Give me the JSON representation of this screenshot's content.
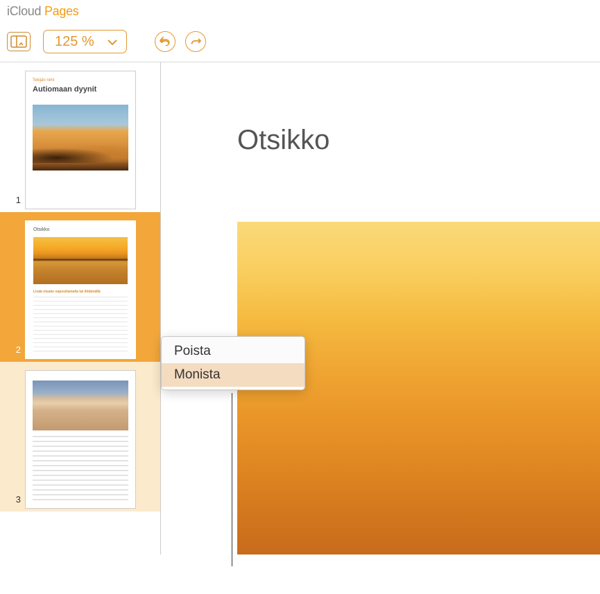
{
  "brand": {
    "icloud": "iCloud",
    "pages": "Pages"
  },
  "toolbar": {
    "zoom_value": "125 %"
  },
  "sidebar": {
    "pages": [
      {
        "num": "1",
        "author_label": "Tekijän nimi",
        "title": "Autiomaan dyynit"
      },
      {
        "num": "2",
        "heading": "Otsikko",
        "subheading": "Lisää otsake napsuttamalla tai liittämällä"
      },
      {
        "num": "3"
      }
    ]
  },
  "canvas": {
    "heading": "Otsikko"
  },
  "context_menu": {
    "items": [
      {
        "label": "Poista"
      },
      {
        "label": "Monista"
      }
    ]
  }
}
